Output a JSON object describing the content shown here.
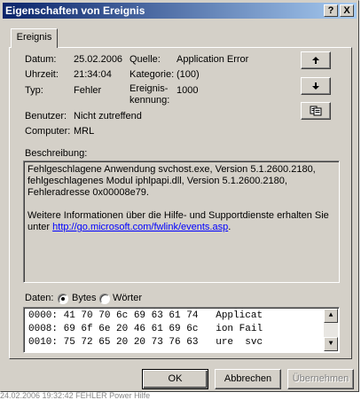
{
  "window": {
    "title": "Eigenschaften von Ereignis",
    "help_label": "?",
    "close_label": "X"
  },
  "tab": {
    "label": "Ereignis"
  },
  "fields": {
    "datum_label": "Datum:",
    "datum_value": "25.02.2006",
    "uhrzeit_label": "Uhrzeit:",
    "uhrzeit_value": "21:34:04",
    "typ_label": "Typ:",
    "typ_value": "Fehler",
    "benutzer_label": "Benutzer:",
    "benutzer_value": "Nicht zutreffend",
    "computer_label": "Computer:",
    "computer_value": "MRL",
    "quelle_label": "Quelle:",
    "quelle_value": "Application Error",
    "kategorie_label": "Kategorie:",
    "kategorie_value": "(100)",
    "kennung_label_1": "Ereignis-",
    "kennung_label_2": "kennung:",
    "kennung_value": "1000"
  },
  "nav": {
    "up_icon": "arrow-up-icon",
    "down_icon": "arrow-down-icon",
    "copy_icon": "copy-icon"
  },
  "description": {
    "label": "Beschreibung:",
    "line1": "Fehlgeschlagene Anwendung svchost.exe, Version 5.1.2600.2180,",
    "line2": "fehlgeschlagenes Modul iphlpapi.dll, Version 5.1.2600.2180,",
    "line3": "Fehleradresse 0x00008e79.",
    "line4": "Weitere Informationen über die Hilfe- und Supportdienste erhalten Sie",
    "line5_prefix": "unter ",
    "link": "http://go.microsoft.com/fwlink/events.asp",
    "line5_suffix": "."
  },
  "data_section": {
    "label": "Daten:",
    "option_bytes": "Bytes",
    "option_words": "Wörter",
    "selected": "Bytes",
    "hex_lines": [
      "0000: 41 70 70 6c 69 63 61 74   Applicat",
      "0008: 69 6f 6e 20 46 61 69 6c   ion Fail",
      "0010: 75 72 65 20 20 73 76 63   ure  svc"
    ]
  },
  "buttons": {
    "ok": "OK",
    "cancel": "Abbrechen",
    "apply": "Übernehmen"
  },
  "background_strip": "24.02.2006    19:32:42    FEHLER                    Power Hilfe"
}
